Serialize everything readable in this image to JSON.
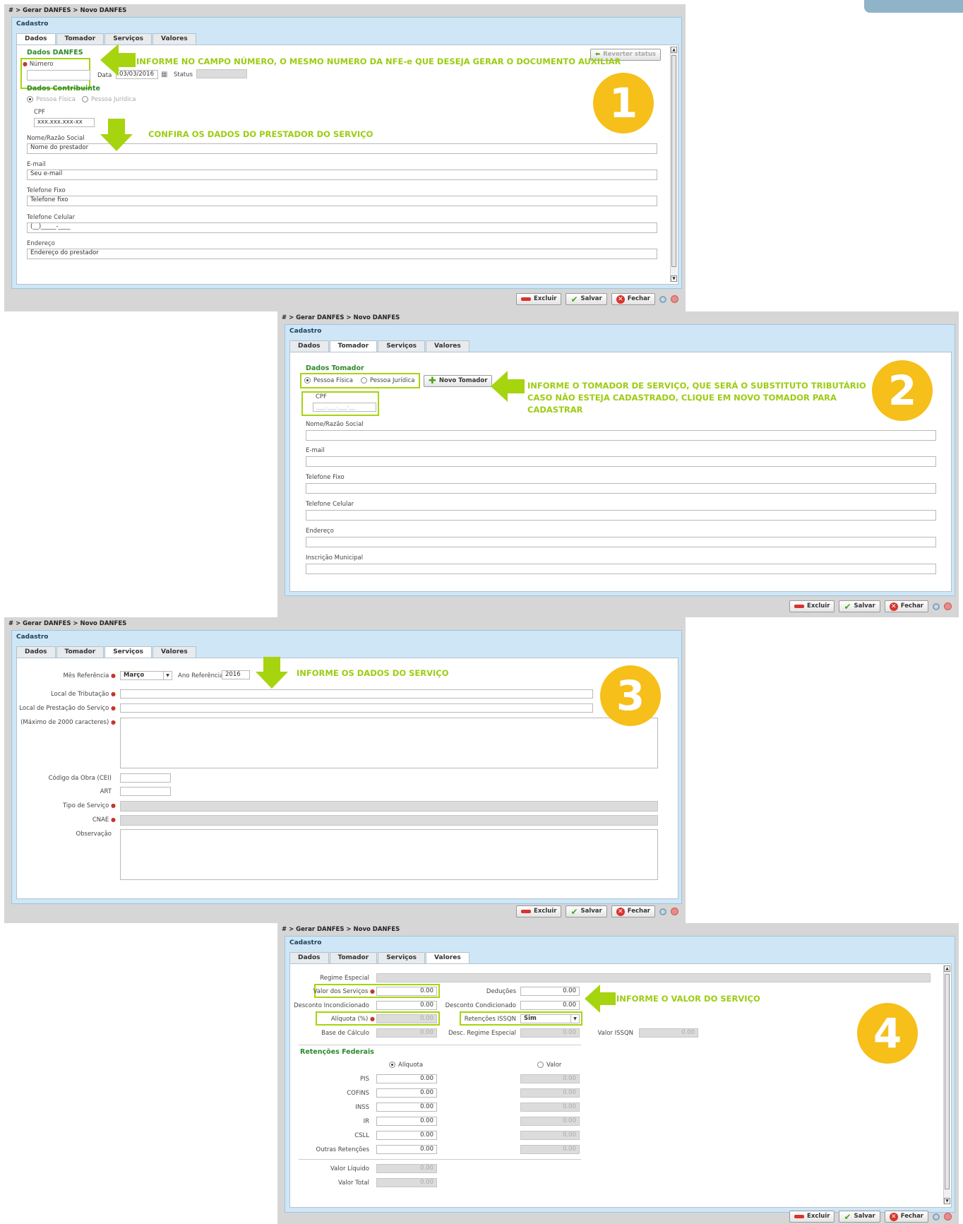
{
  "breadcrumb": "# > Gerar DANFES > Novo DANFES",
  "panel_title": "Cadastro",
  "tabs": [
    "Dados",
    "Tomador",
    "Serviços",
    "Valores"
  ],
  "buttons": {
    "excluir": "Excluir",
    "salvar": "Salvar",
    "fechar": "Fechar",
    "reverter": "Reverter status"
  },
  "step1": {
    "section_danfes": "Dados DANFES",
    "numero_label": "Número",
    "numero_value": "",
    "data_label": "Data",
    "data_value": "03/03/2016",
    "status_label": "Status",
    "section_contribuinte": "Dados Contribuinte",
    "radio_pf": "Pessoa Física",
    "radio_pj": "Pessoa Jurídica",
    "cpf_label": "CPF",
    "cpf_value": "xxx.xxx.xxx-xx",
    "nome_label": "Nome/Razão Social",
    "nome_value": "Nome do prestador",
    "email_label": "E-mail",
    "email_value": "Seu e-mail",
    "fixo_label": "Telefone Fixo",
    "fixo_value": "Telefone fixo",
    "celular_label": "Telefone Celular",
    "celular_value": "(__)_____-____",
    "endereco_label": "Endereço",
    "endereco_value": "Endereço do prestador",
    "note_top": "INFORME NO CAMPO NÚMERO,  O MESMO NUMERO DA NFE-e QUE DESEJA GERAR O DOCUMENTO AUXILIAR",
    "note_mid": "CONFIRA OS DADOS DO PRESTADOR DO SERVIÇO",
    "badge": "1"
  },
  "step2": {
    "section": "Dados Tomador",
    "radio_pf": "Pessoa Física",
    "radio_pj": "Pessoa Jurídica",
    "novo_tomador": "Novo Tomador",
    "cpf_label": "CPF",
    "cpf_value": "___.___.___-__",
    "nome_label": "Nome/Razão Social",
    "email_label": "E-mail",
    "fixo_label": "Telefone Fixo",
    "celular_label": "Telefone Celular",
    "endereco_label": "Endereço",
    "inscricao_label": "Inscrição Municipal",
    "note_line1": "INFORME O TOMADOR DE SERVIÇO, QUE SERÁ O SUBSTITUTO TRIBUTÁRIO",
    "note_line2": "CASO NÃO ESTEJA CADASTRADO, CLIQUE EM NOVO TOMADOR PARA",
    "note_line3": "CADASTRAR",
    "badge": "2"
  },
  "step3": {
    "mes_label": "Mês Referência",
    "mes_value": "Março",
    "ano_label": "Ano Referência",
    "ano_value": "2016",
    "local_trib_label": "Local de Tributação",
    "local_prest_label": "Local de Prestação do Serviço",
    "maximo_label": "(Máximo de 2000 caracteres)",
    "codigo_obra_label": "Código da Obra (CEI)",
    "art_label": "ART",
    "tipo_servico_label": "Tipo de Serviço",
    "cnae_label": "CNAE",
    "observacao_label": "Observação",
    "note": "INFORME OS DADOS DO SERVIÇO",
    "badge": "3"
  },
  "step4": {
    "regime_label": "Regime Especial",
    "valor_servicos_label": "Valor dos Serviços",
    "valor_servicos_value": "0.00",
    "deducoes_label": "Deduções",
    "deducoes_value": "0.00",
    "desc_incond_label": "Desconto Incondicionado",
    "desc_incond_value": "0.00",
    "desc_cond_label": "Desconto Condicionado",
    "desc_cond_value": "0.00",
    "aliquota_label": "Alíquota (%)",
    "aliquota_value": "0.00",
    "retencoes_issqn_label": "Retenções ISSQN",
    "retencoes_issqn_value": "Sim",
    "base_calculo_label": "Base de Cálculo",
    "base_calculo_value": "0.00",
    "desc_regime_label": "Desc. Regime Especial",
    "desc_regime_value": "0.00",
    "valor_issqn_label": "Valor ISSQN",
    "valor_issqn_value": "0.00",
    "section_retencoes": "Retenções Federais",
    "radio_aliquota": "Alíquota",
    "radio_valor": "Valor",
    "federais": [
      {
        "label": "PIS",
        "aliquota": "0.00",
        "valor": "0.00"
      },
      {
        "label": "COFINS",
        "aliquota": "0.00",
        "valor": "0.00"
      },
      {
        "label": "INSS",
        "aliquota": "0.00",
        "valor": "0.00"
      },
      {
        "label": "IR",
        "aliquota": "0.00",
        "valor": "0.00"
      },
      {
        "label": "CSLL",
        "aliquota": "0.00",
        "valor": "0.00"
      },
      {
        "label": "Outras Retenções",
        "aliquota": "0.00",
        "valor": "0.00"
      }
    ],
    "valor_liquido_label": "Valor Líquido",
    "valor_liquido_value": "0.00",
    "valor_total_label": "Valor Total",
    "valor_total_value": "0.00",
    "note": "INFORME O VALOR DO SERVIÇO",
    "badge": "4"
  },
  "colors": {
    "accent_green": "#9ccc12",
    "badge_yellow": "#f6bf19",
    "section_green": "#2d8a2d",
    "panel_blue": "#cfe6f6"
  }
}
